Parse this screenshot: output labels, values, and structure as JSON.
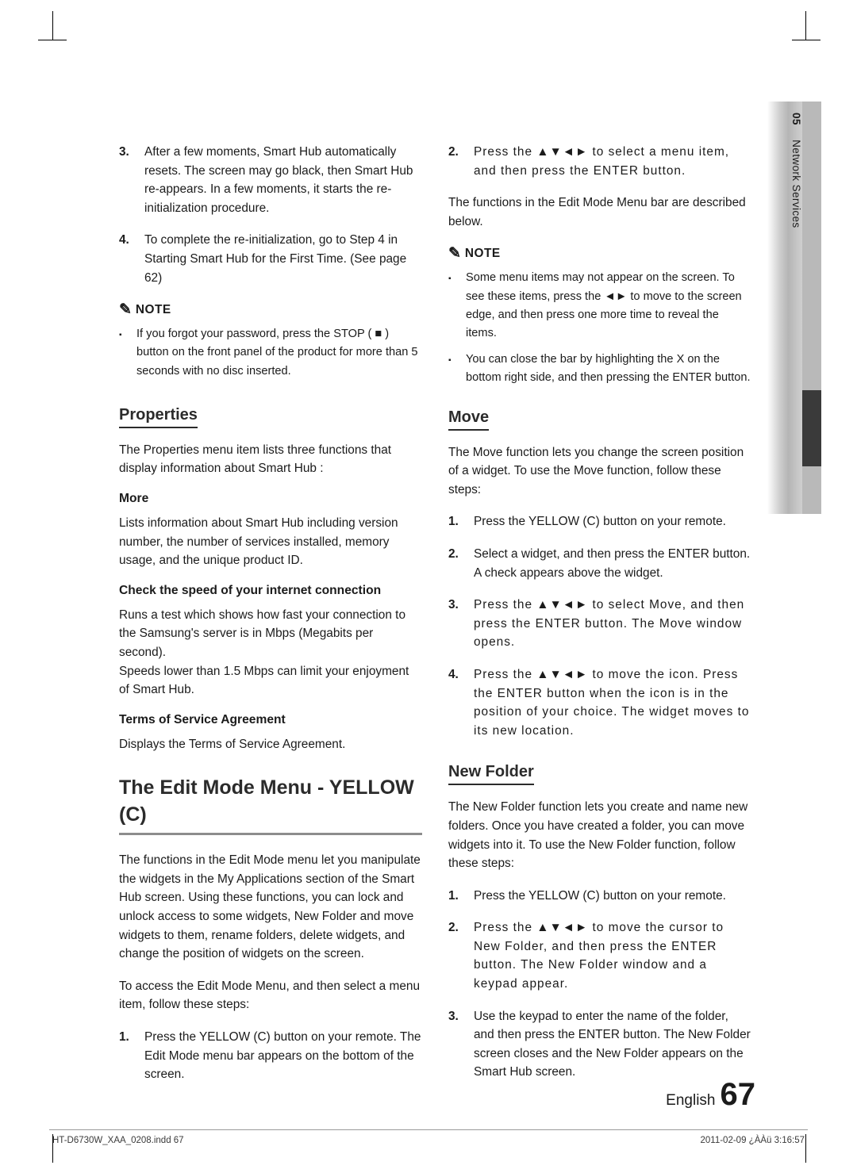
{
  "side_tab": {
    "number": "05",
    "label": "Network Services"
  },
  "left_column": {
    "steps": [
      {
        "n": "3.",
        "text": "After a few moments, Smart Hub automatically resets. The screen may go black, then Smart Hub re-appears. In a few moments, it starts the re-initialization procedure."
      },
      {
        "n": "4.",
        "text": "To complete the re-initialization, go to Step 4 in Starting Smart Hub for the First Time. (See page 62)"
      }
    ],
    "note_label": "NOTE",
    "note_items": [
      "If you forgot your password, press the STOP ( ■ ) button on the front panel of the product for more than 5 seconds with no disc inserted."
    ],
    "properties_heading": "Properties",
    "properties_intro": "The Properties menu item lists three functions that display information about Smart Hub :",
    "more_heading": "More",
    "more_text": "Lists information about Smart Hub including version number, the number of services installed, memory usage, and the unique product ID.",
    "speed_heading": "Check the speed of your internet connection",
    "speed_text_1": "Runs a test which shows how fast your connection to the Samsung's server is in Mbps (Megabits per second).",
    "speed_text_2": "Speeds lower than 1.5 Mbps can limit your enjoyment of Smart Hub.",
    "terms_heading": "Terms of Service Agreement",
    "terms_text": "Displays the Terms of Service Agreement.",
    "big_title": "The Edit Mode Menu - YELLOW (C)",
    "edit_intro_1": "The functions in the Edit Mode menu let you manipulate the widgets in the My Applications section of the Smart Hub screen. Using these functions, you can lock and unlock access to some widgets, New Folder and move widgets to them, rename folders, delete widgets, and change the position of widgets on the screen.",
    "edit_intro_2": "To access the Edit Mode Menu, and then select a menu item, follow these steps:",
    "edit_step_1_n": "1.",
    "edit_step_1_text": "Press the YELLOW (C) button on your remote. The Edit Mode menu bar appears on the bottom of the screen."
  },
  "right_column": {
    "step2_n": "2.",
    "step2_text": "Press the ▲▼◄► to select a menu item, and then press the ENTER button.",
    "intro": "The functions in the Edit Mode Menu bar are described below.",
    "note_label": "NOTE",
    "note_items": [
      "Some menu items may not appear on the screen. To see these items, press the ◄► to move to the screen edge, and then press one more time to reveal the items.",
      "You can close the bar by highlighting the X on the bottom right side, and then pressing the ENTER button."
    ],
    "move_heading": "Move",
    "move_intro": "The Move function lets you change the screen position of a widget. To use the Move function, follow these steps:",
    "move_steps": [
      {
        "n": "1.",
        "text": "Press the YELLOW (C) button on your remote."
      },
      {
        "n": "2.",
        "text": "Select a widget, and then press the ENTER button. A check appears above the widget."
      },
      {
        "n": "3.",
        "text": "Press the ▲▼◄► to select Move, and then press the ENTER button. The Move window opens."
      },
      {
        "n": "4.",
        "text": "Press the ▲▼◄► to move the icon. Press the ENTER button when the icon is in the position of your choice. The widget moves to its new location."
      }
    ],
    "new_folder_heading": "New Folder",
    "new_folder_intro": "The New Folder function lets you create and name new folders. Once you have created a folder, you can move widgets into it. To use the New Folder function, follow these steps:",
    "new_folder_steps": [
      {
        "n": "1.",
        "text": "Press the YELLOW (C) button on your remote."
      },
      {
        "n": "2.",
        "text": "Press the ▲▼◄► to move the cursor to New Folder, and then press the ENTER button. The New Folder window and a keypad appear."
      },
      {
        "n": "3.",
        "text": "Use the keypad to enter the name of the folder, and then press the ENTER button. The New Folder screen closes and the New Folder appears on the Smart Hub screen."
      }
    ]
  },
  "footer": {
    "english_label": "English",
    "page_number": "67",
    "file_name": "HT-D6730W_XAA_0208.indd   67",
    "timestamp": "2011-02-09   ¿ÀÀü 3:16:57"
  }
}
